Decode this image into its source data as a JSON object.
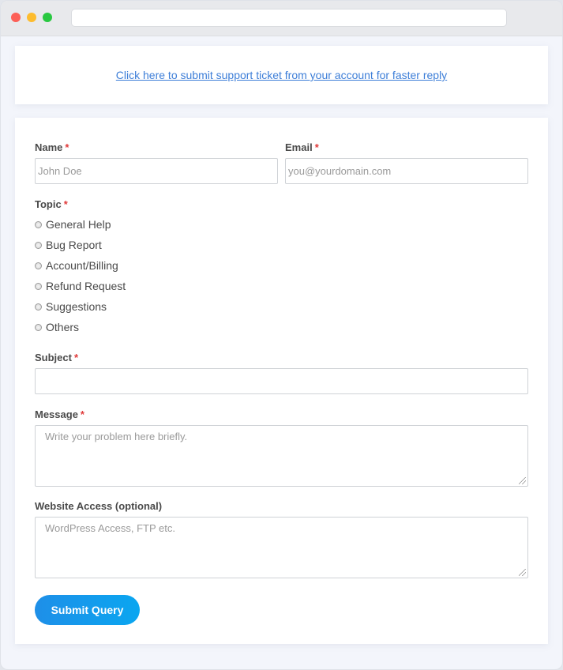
{
  "banner": {
    "link_text": "Click here to submit support ticket from your account for faster reply"
  },
  "form": {
    "name": {
      "label": "Name",
      "required": "*",
      "placeholder": "John Doe"
    },
    "email": {
      "label": "Email",
      "required": "*",
      "placeholder": "you@yourdomain.com"
    },
    "topic": {
      "label": "Topic",
      "required": "*",
      "options": [
        "General Help",
        "Bug Report",
        "Account/Billing",
        "Refund Request",
        "Suggestions",
        "Others"
      ]
    },
    "subject": {
      "label": "Subject",
      "required": "*",
      "value": ""
    },
    "message": {
      "label": "Message",
      "required": "*",
      "placeholder": "Write your problem here briefly."
    },
    "website_access": {
      "label": "Website Access (optional)",
      "placeholder": "WordPress Access, FTP etc."
    },
    "submit_label": "Submit Query"
  },
  "colors": {
    "accent": "#1e8fe8",
    "link": "#3d7ed8",
    "required": "#e03b3b"
  }
}
